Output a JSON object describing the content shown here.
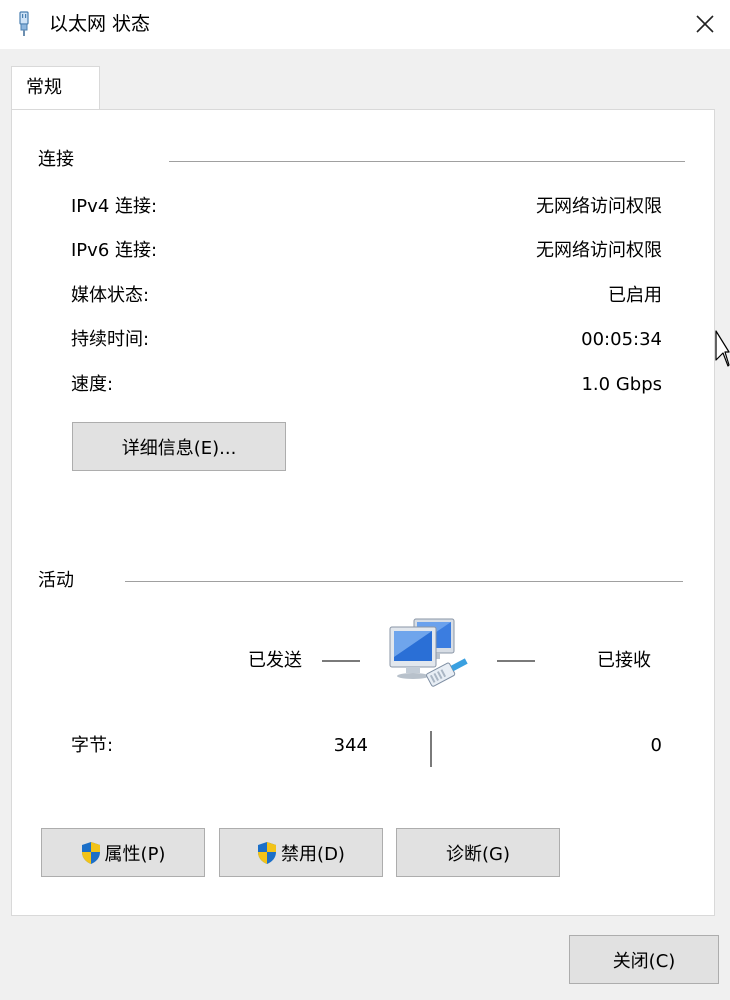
{
  "window": {
    "title": "以太网 状态"
  },
  "tabs": [
    {
      "label": "常规"
    }
  ],
  "connection": {
    "header": "连接",
    "rows": [
      {
        "label": "IPv4 连接:",
        "value": "无网络访问权限"
      },
      {
        "label": "IPv6 连接:",
        "value": "无网络访问权限"
      },
      {
        "label": "媒体状态:",
        "value": "已启用"
      },
      {
        "label": "持续时间:",
        "value": "00:05:34"
      },
      {
        "label": "速度:",
        "value": "1.0 Gbps"
      }
    ],
    "details_button": "详细信息(E)..."
  },
  "activity": {
    "header": "活动",
    "sent_label": "已发送",
    "received_label": "已接收",
    "bytes_label": "字节:",
    "bytes_sent": "344",
    "bytes_received": "0"
  },
  "actions": {
    "properties": "属性(P)",
    "disable": "禁用(D)",
    "diagnose": "诊断(G)"
  },
  "footer": {
    "close": "关闭(C)"
  },
  "colors": {
    "shield_blue": "#1b6fc8",
    "shield_yellow": "#f2c318",
    "monitor_blue": "#2a6fd6"
  }
}
